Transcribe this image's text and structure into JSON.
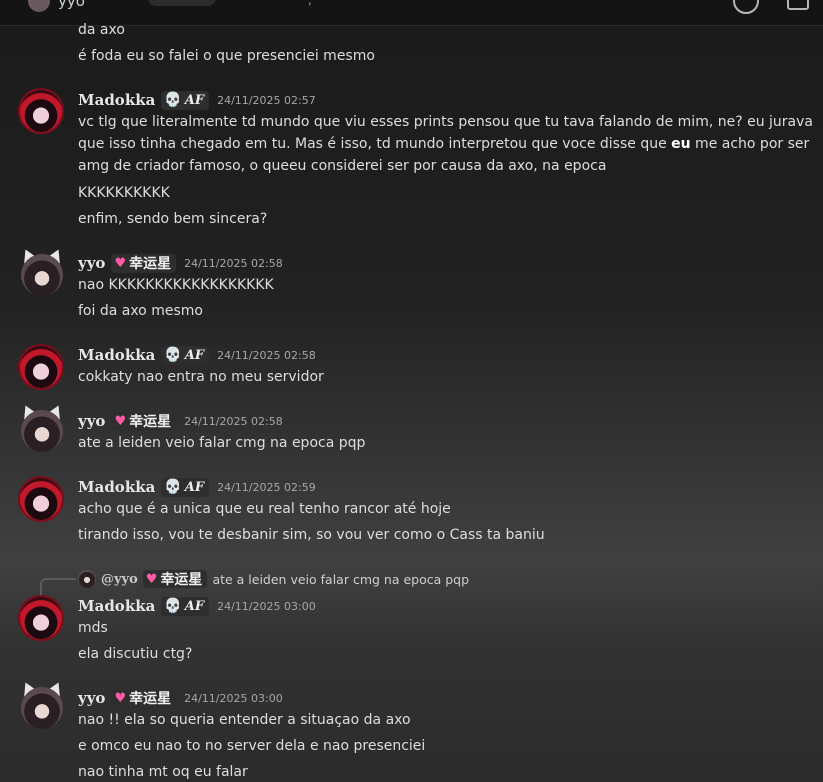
{
  "topbar": {
    "name": "yyo",
    "mark": ",",
    "avatar_icon": "user-avatar-icon"
  },
  "colors": {
    "badge_bg": "#2e2e2e",
    "skull": "#c89cff",
    "heart": "#ff5aa5",
    "text": "#dbdee1"
  },
  "messages": [
    {
      "lines": [
        "da axo",
        "é foda eu so falei o que presenciei mesmo"
      ]
    },
    {
      "author": "Madokka",
      "tag": "AF",
      "tag_icon": "skull-icon",
      "time": "24/11/2025 02:57",
      "lines": [
        "vc tlg que literalmente td mundo que viu esses prints pensou que tu tava falando de mim, ne? eu jurava que isso tinha chegado em tu. Mas é isso, td mundo interpretou que voce disse que ",
        "eu",
        " me acho por ser amg de criador famoso, o queeu considerei ser por causa da axo, na epoca",
        "KKKKKKKKKK",
        "enfim, sendo bem sincera?"
      ]
    },
    {
      "author": "yyo",
      "tag": "幸运星",
      "tag_icon": "heart-icon",
      "time": "24/11/2025 02:58",
      "lines": [
        "nao KKKKKKKKKKKKKKKKKK",
        "foi da axo mesmo"
      ]
    },
    {
      "author": "Madokka",
      "tag": "AF",
      "tag_icon": "skull-icon",
      "time": "24/11/2025 02:58",
      "lines": [
        "cokkaty nao entra no meu servidor"
      ]
    },
    {
      "author": "yyo",
      "tag": "幸运星",
      "tag_icon": "heart-icon",
      "time": "24/11/2025 02:58",
      "lines": [
        "ate a leiden veio falar cmg na epoca pqp"
      ]
    },
    {
      "author": "Madokka",
      "tag": "AF",
      "tag_icon": "skull-icon",
      "time": "24/11/2025 02:59",
      "lines": [
        "acho que é a unica que eu real tenho rancor até hoje",
        "tirando isso, vou te desbanir sim, so vou ver como o Cass ta baniu"
      ]
    },
    {
      "reply": {
        "name": "@yyo",
        "tag": "幸运星",
        "text": "ate a leiden veio falar cmg na epoca pqp"
      },
      "author": "Madokka",
      "tag": "AF",
      "tag_icon": "skull-icon",
      "time": "24/11/2025 03:00",
      "lines": [
        "mds",
        "ela discutiu ctg?"
      ]
    },
    {
      "author": "yyo",
      "tag": "幸运星",
      "tag_icon": "heart-icon",
      "time": "24/11/2025 03:00",
      "lines": [
        "nao !! ela so queria entender a situaçao da axo",
        "e omco eu nao to no server dela e nao presenciei",
        "nao tinha mt oq eu falar"
      ]
    }
  ]
}
